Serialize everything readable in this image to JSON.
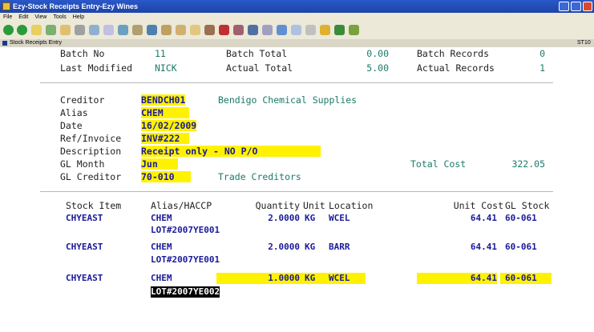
{
  "window": {
    "title": "Ezy-Stock Receipts Entry-Ezy Wines"
  },
  "menu": [
    "File",
    "Edit",
    "View",
    "Tools",
    "Help"
  ],
  "sub_window": {
    "title": "Stock Receipts Entry",
    "code": "ST10"
  },
  "batch": {
    "batch_no_label": "Batch No",
    "batch_no": "11",
    "batch_total_label": "Batch Total",
    "batch_total": "0.00",
    "batch_records_label": "Batch Records",
    "batch_records": "0",
    "last_modified_label": "Last Modified",
    "last_modified": "NICK",
    "actual_total_label": "Actual Total",
    "actual_total": "5.00",
    "actual_records_label": "Actual Records",
    "actual_records": "1"
  },
  "form": {
    "creditor_label": "Creditor",
    "creditor": "BENDCH01",
    "creditor_name": "Bendigo Chemical Supplies",
    "alias_label": "Alias",
    "alias": "CHEM",
    "date_label": "Date",
    "date": "16/02/2009",
    "ref_label": "Ref/Invoice",
    "ref": "INV#222",
    "desc_label": "Description",
    "desc": "Receipt only - NO P/O",
    "gl_month_label": "GL Month",
    "gl_month": "Jun",
    "total_cost_label": "Total Cost",
    "total_cost": "322.05",
    "gl_creditor_label": "GL Creditor",
    "gl_creditor": "70-010",
    "gl_creditor_name": "Trade Creditors"
  },
  "table": {
    "headers": [
      "Stock Item",
      "Alias/HACCP",
      "Quantity",
      "Unit",
      "Location",
      "Unit Cost",
      "GL Stock"
    ],
    "rows": [
      {
        "item": "CHYEAST",
        "alias": "CHEM",
        "lot": "LOT#2007YE001",
        "qty": "2.0000",
        "unit": "KG",
        "loc": "WCEL",
        "cost": "64.41",
        "gl": "60-061"
      },
      {
        "item": "CHYEAST",
        "alias": "CHEM",
        "lot": "LOT#2007YE001",
        "qty": "2.0000",
        "unit": "KG",
        "loc": "BARR",
        "cost": "64.41",
        "gl": "60-061"
      },
      {
        "item": "CHYEAST",
        "alias": "CHEM",
        "lot": "LOT#2007YE002",
        "qty": "1.0000",
        "unit": "KG",
        "loc": "WCEL",
        "cost": "64.41",
        "gl": "60-061"
      }
    ]
  },
  "colors": {
    "highlight": "#fff200",
    "value_text": "#1a1a9a",
    "name_text": "#1a7a6a"
  }
}
